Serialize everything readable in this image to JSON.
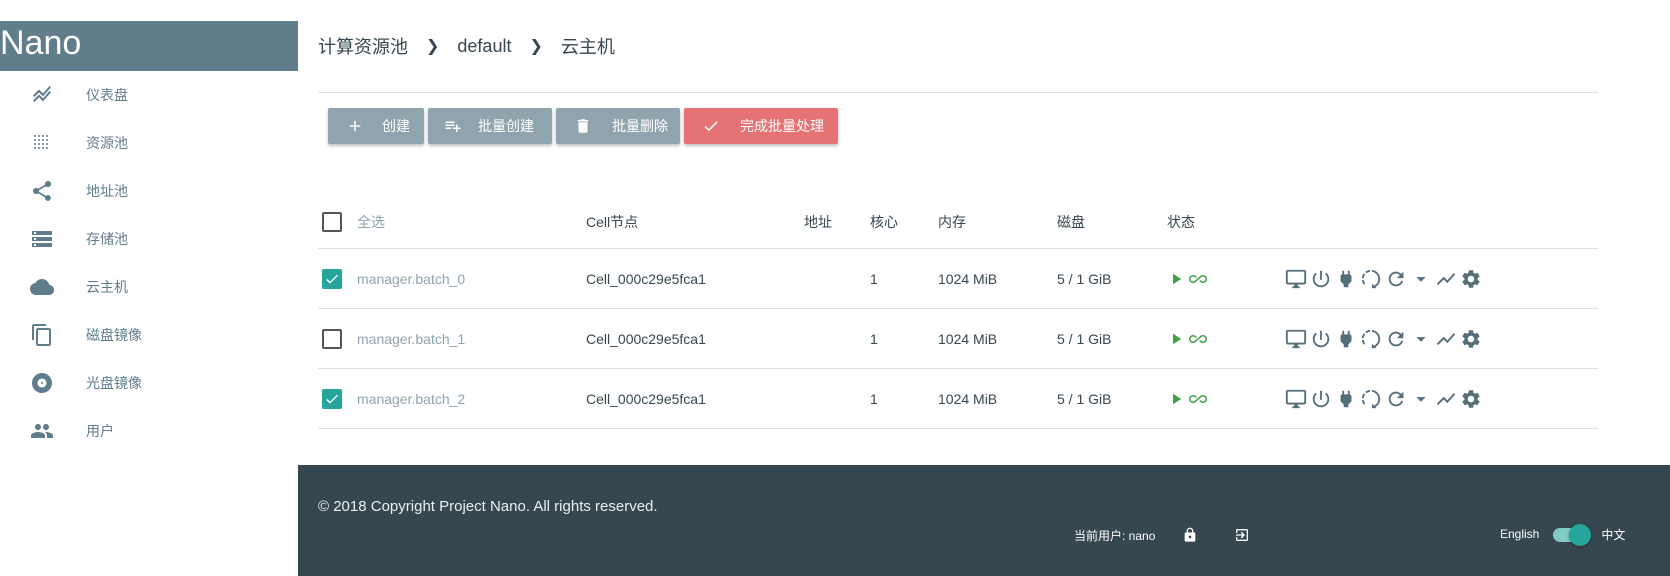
{
  "app": {
    "brand": "Nano"
  },
  "sidebar": {
    "items": [
      {
        "label": "仪表盘",
        "icon": "chart-line-icon"
      },
      {
        "label": "资源池",
        "icon": "grid-dots-icon"
      },
      {
        "label": "地址池",
        "icon": "share-icon"
      },
      {
        "label": "存储池",
        "icon": "storage-icon"
      },
      {
        "label": "云主机",
        "icon": "cloud-icon"
      },
      {
        "label": "磁盘镜像",
        "icon": "copy-icon"
      },
      {
        "label": "光盘镜像",
        "icon": "disc-icon"
      },
      {
        "label": "用户",
        "icon": "people-icon"
      }
    ]
  },
  "breadcrumb": [
    "计算资源池",
    "default",
    "云主机"
  ],
  "toolbar": {
    "create": "创建",
    "batch_create": "批量创建",
    "batch_delete": "批量删除",
    "finish_batch": "完成批量处理"
  },
  "table": {
    "headers": {
      "select_all": "全选",
      "cell": "Cell节点",
      "address": "地址",
      "cores": "核心",
      "memory": "内存",
      "disk": "磁盘",
      "status": "状态"
    },
    "rows": [
      {
        "checked": true,
        "name": "manager.batch_0",
        "cell": "Cell_000c29e5fca1",
        "address": "",
        "cores": "1",
        "memory": "1024 MiB",
        "disk": "5 / 1 GiB"
      },
      {
        "checked": false,
        "name": "manager.batch_1",
        "cell": "Cell_000c29e5fca1",
        "address": "",
        "cores": "1",
        "memory": "1024 MiB",
        "disk": "5 / 1 GiB"
      },
      {
        "checked": true,
        "name": "manager.batch_2",
        "cell": "Cell_000c29e5fca1",
        "address": "",
        "cores": "1",
        "memory": "1024 MiB",
        "disk": "5 / 1 GiB"
      }
    ]
  },
  "footer": {
    "copyright": "© 2018 Copyright Project Nano. All rights reserved.",
    "current_user": "当前用户: nano",
    "lang_en": "English",
    "lang_zh": "中文"
  },
  "colors": {
    "brand": "#607d8b",
    "button_gray": "#90a4ae",
    "button_red": "#e57373",
    "accent": "#26a69a",
    "running": "#43a047",
    "footer": "#37474f"
  }
}
